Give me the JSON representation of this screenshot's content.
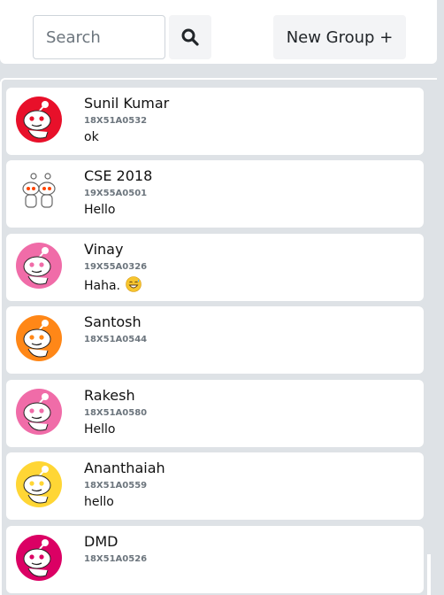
{
  "search": {
    "placeholder": "Search",
    "button_icon": "search-icon"
  },
  "new_group_label": "New Group +",
  "chats": [
    {
      "name": "Sunil Kumar",
      "id": "18X51A0532",
      "message": "ok",
      "avatar": "snoo-avatar",
      "avatar_color": "#e8102a"
    },
    {
      "name": "CSE 2018",
      "id": "19X55A0501",
      "message": "Hello",
      "avatar": "group-avatar",
      "avatar_color": "#ffffff"
    },
    {
      "name": "Vinay",
      "id": "19X55A0326",
      "message": "Haha.",
      "avatar": "snoo-avatar",
      "avatar_color": "#f06ca8",
      "emoji": "grinning-sweat-emoji"
    },
    {
      "name": "Santosh",
      "id": "18X51A0544",
      "message": "",
      "avatar": "snoo-avatar",
      "avatar_color": "#ff8717"
    },
    {
      "name": "Rakesh",
      "id": "18X51A0580",
      "message": "Hello",
      "avatar": "snoo-avatar",
      "avatar_color": "#f06ca8"
    },
    {
      "name": "Ananthaiah",
      "id": "18X51A0559",
      "message": "hello",
      "avatar": "snoo-avatar",
      "avatar_color": "#ffd635"
    },
    {
      "name": "DMD",
      "id": "18X51A0526",
      "message": "",
      "avatar": "snoo-avatar",
      "avatar_color": "#db0064"
    }
  ]
}
